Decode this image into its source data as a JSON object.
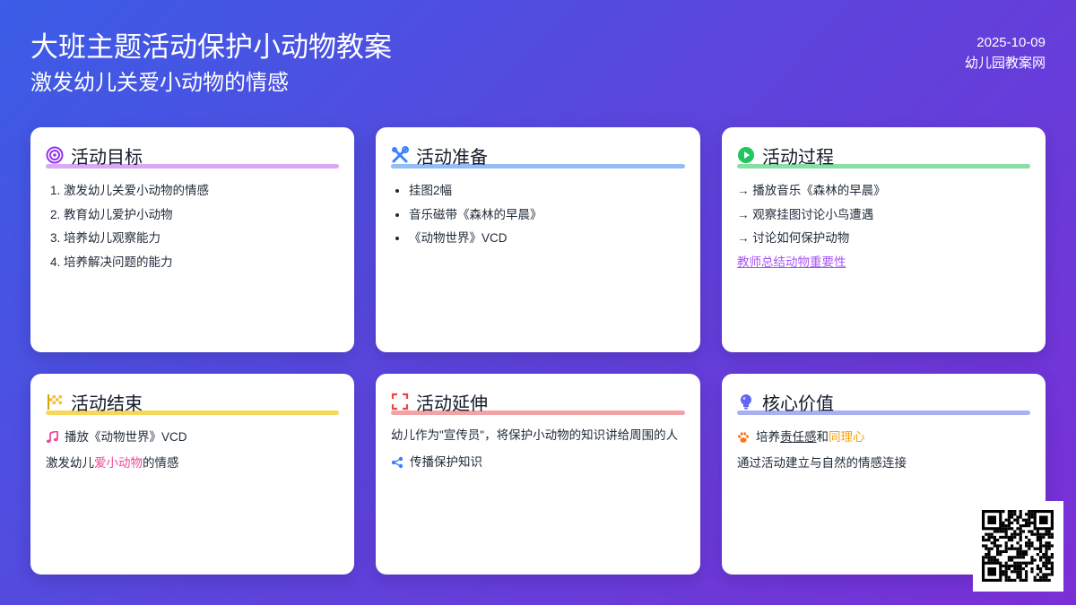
{
  "header": {
    "title": "大班主题活动保护小动物教案",
    "subtitle": "激发幼儿关爱小动物的情感",
    "date": "2025-10-09",
    "source": "幼儿园教案网"
  },
  "colors": {
    "purple": "#d8a9f5",
    "blue": "#93bdf5",
    "green": "#86e0a5",
    "yellow": "#f6d75a",
    "red": "#f2a3a6",
    "indigo": "#a7b0f3"
  },
  "cards": {
    "goals": {
      "title": "活动目标",
      "icon": "target-icon",
      "items": [
        "激发幼儿关爱小动物的情感",
        "教育幼儿爱护小动物",
        "培养幼儿观察能力",
        "培养解决问题的能力"
      ]
    },
    "prep": {
      "title": "活动准备",
      "icon": "tools-icon",
      "items": [
        "挂图2幅",
        "音乐磁带《森林的早晨》",
        "《动物世界》VCD"
      ]
    },
    "process": {
      "title": "活动过程",
      "icon": "play-icon",
      "items": [
        "→ 播放音乐《森林的早晨》",
        "→ 观察挂图讨论小鸟遭遇",
        "→ 讨论如何保护动物"
      ],
      "link": "教师总结动物重要性"
    },
    "end": {
      "title": "活动结束",
      "icon": "flag-icon",
      "music": "播放《动物世界》VCD",
      "text_pre": "激发幼儿",
      "text_highlight": "爱小动物",
      "text_post": "的情感"
    },
    "extend": {
      "title": "活动延伸",
      "icon": "expand-icon",
      "text": "幼儿作为\"宣传员\"，将保护小动物的知识讲给周围的人",
      "share": "传播保护知识"
    },
    "value": {
      "title": "核心价值",
      "icon": "lightbulb-icon",
      "pre": "培养",
      "u": "责任感",
      "and": "和",
      "o": "同理心",
      "text": "通过活动建立与自然的情感连接"
    }
  }
}
